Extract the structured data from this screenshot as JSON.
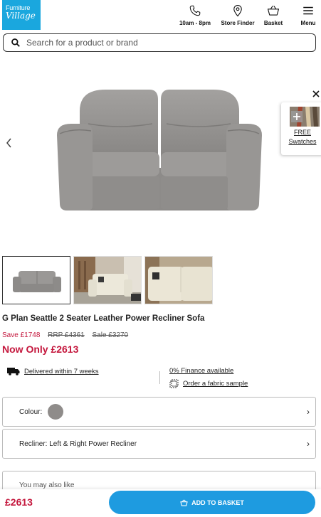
{
  "header": {
    "logo_line1": "Furniture",
    "logo_line2": "Village",
    "phone_label": "10am - 8pm",
    "store_label": "Store Finder",
    "basket_label": "Basket",
    "menu_label": "Menu"
  },
  "search": {
    "placeholder": "Search for a product or brand"
  },
  "gallery": {
    "swatch_free": "FREE",
    "swatch_label": "Swatches",
    "thumbnail_count": 3,
    "active_thumbnail": 1
  },
  "product": {
    "title": "G Plan Seattle 2 Seater Leather Power Recliner Sofa",
    "save": "Save £1748",
    "rrp": "RRP £4361",
    "sale": "Sale £3270",
    "now_only": "Now Only £2613"
  },
  "info": {
    "delivery": "Delivered within 7 weeks",
    "finance": "0% Finance available",
    "fabric_sample": "Order a fabric sample"
  },
  "options": {
    "colour_label": "Colour:",
    "colour_value": "#8f8c8a",
    "recliner_label": "Recliner: Left & Right Power Recliner",
    "may_also_like": "You may also like"
  },
  "footer": {
    "price": "£2613",
    "add_to_basket": "ADD TO BASKET"
  },
  "colors": {
    "brand": "#1aa7de",
    "button": "#1e9be0",
    "sale": "#c4163c"
  }
}
